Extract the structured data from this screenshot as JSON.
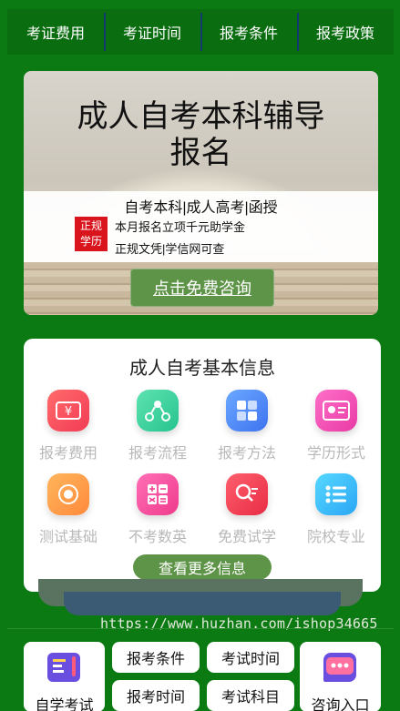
{
  "topnav": {
    "tabs": [
      "考证费用",
      "考证时间",
      "报考条件",
      "报考政策"
    ]
  },
  "banner": {
    "title_line1": "成人自考本科辅导",
    "title_line2": "报名",
    "subtitle": "自考本科|成人高考|函授",
    "badge_line1": "正规",
    "badge_line2": "学历",
    "line1": "本月报名立项千元助学金",
    "line2": "正规文凭|学信网可查",
    "cta": "点击免费咨询"
  },
  "info": {
    "heading": "成人自考基本信息",
    "items": [
      {
        "label": "报考费用",
        "icon": "yuan-ticket-icon",
        "colors": [
          "#ff6b6b",
          "#f23b55"
        ]
      },
      {
        "label": "报考流程",
        "icon": "flow-nodes-icon",
        "colors": [
          "#5de3b0",
          "#27c38f"
        ]
      },
      {
        "label": "报考方法",
        "icon": "grid-blocks-icon",
        "colors": [
          "#6aa8ff",
          "#3f73f0"
        ]
      },
      {
        "label": "学历形式",
        "icon": "id-card-icon",
        "colors": [
          "#ff6fc8",
          "#e83aa5"
        ]
      },
      {
        "label": "测试基础",
        "icon": "coin-icon",
        "colors": [
          "#ffb55c",
          "#ff8a3c"
        ]
      },
      {
        "label": "不考数英",
        "icon": "math-symbols-icon",
        "colors": [
          "#ff6fb6",
          "#ef3b8c"
        ]
      },
      {
        "label": "免费试学",
        "icon": "search-list-icon",
        "colors": [
          "#ff5f6d",
          "#e82c45"
        ]
      },
      {
        "label": "院校专业",
        "icon": "list-icon",
        "colors": [
          "#56d8ff",
          "#2aa6f5"
        ]
      }
    ],
    "more": "查看更多信息"
  },
  "watermark": "https://www.huzhan.com/ishop34665",
  "bottom": {
    "left_card": "自学考试",
    "pills": [
      "报考条件",
      "考试时间",
      "报考时间",
      "考试科目"
    ],
    "right_card": "咨询入口"
  }
}
